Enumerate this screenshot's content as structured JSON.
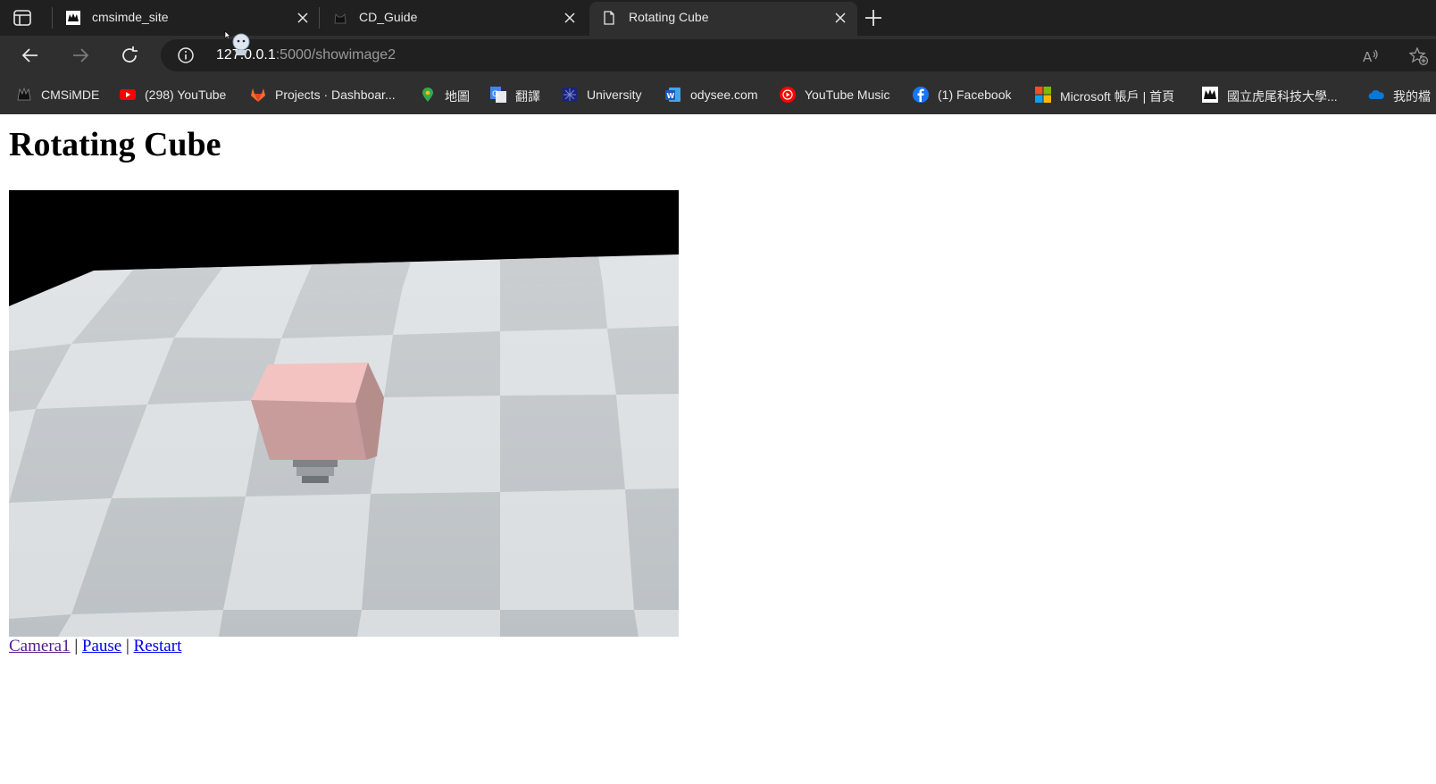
{
  "browser": {
    "tabs": [
      {
        "title": "cmsimde_site",
        "active": false,
        "favicon": "cmsimde-icon"
      },
      {
        "title": "CD_Guide",
        "active": false,
        "favicon": "cat-icon"
      },
      {
        "title": "Rotating Cube",
        "active": true,
        "favicon": "page-icon"
      }
    ],
    "address": {
      "host": "127.0.0.1",
      "rest": ":5000/showimage2"
    },
    "bookmarks": [
      {
        "label": "CMSiMDE",
        "icon": "cmsimde-icon"
      },
      {
        "label": "(298) YouTube",
        "icon": "youtube-icon"
      },
      {
        "label": "Projects · Dashboar...",
        "icon": "gitlab-icon"
      },
      {
        "label": "地圖",
        "icon": "maps-icon"
      },
      {
        "label": "翻譯",
        "icon": "translate-icon"
      },
      {
        "label": "University",
        "icon": "university-icon"
      },
      {
        "label": "odysee.com",
        "icon": "word-icon"
      },
      {
        "label": "YouTube Music",
        "icon": "youtube-music-icon"
      },
      {
        "label": "(1) Facebook",
        "icon": "facebook-icon"
      },
      {
        "label": "Microsoft 帳戶 | 首頁",
        "icon": "microsoft-icon"
      },
      {
        "label": "國立虎尾科技大學...",
        "icon": "nfu-icon"
      },
      {
        "label": "我的檔",
        "icon": "onedrive-icon"
      }
    ]
  },
  "page": {
    "title": "Rotating Cube",
    "controls": {
      "camera": "Camera1",
      "sep1": " | ",
      "pause": "Pause",
      "sep2": " | ",
      "restart": "Restart"
    }
  },
  "colors": {
    "tab_strip": "#202020",
    "toolbar": "#2f2f2f",
    "cube_top": "#f2c3c1",
    "cube_side": "#c79c9a",
    "floor_light": "#d9dde0",
    "floor_dark": "#bcc1c5",
    "visited_link": "#551a8b",
    "link": "#0000ee"
  }
}
